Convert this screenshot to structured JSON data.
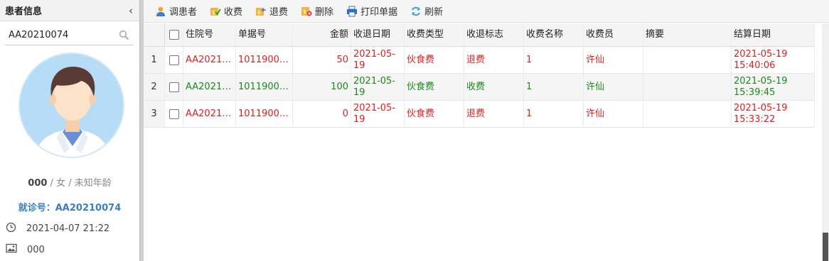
{
  "left": {
    "title": "患者信息",
    "search_value": "AA20210074",
    "patient_id": "000",
    "patient_rest": " / 女 / 未知年龄",
    "visit_no": "就诊号：AA20210074",
    "datetime": "2021-04-07 21:22",
    "photo_text": "000"
  },
  "toolbar": {
    "items": [
      {
        "label": "调患者",
        "icon": "user-icon"
      },
      {
        "label": "收费",
        "icon": "charge-icon"
      },
      {
        "label": "退费",
        "icon": "refund-icon"
      },
      {
        "label": "删除",
        "icon": "delete-icon"
      },
      {
        "label": "打印单据",
        "icon": "print-icon"
      },
      {
        "label": "刷新",
        "icon": "refresh-icon"
      }
    ]
  },
  "grid": {
    "headers": [
      "住院号",
      "单据号",
      "金额",
      "收退日期",
      "收费类型",
      "收退标志",
      "收费名称",
      "收费员",
      "摘要",
      "结算日期"
    ],
    "rows": [
      {
        "num": "1",
        "zyh": "AA2021…",
        "djh": "1011900…",
        "je": "50",
        "rq": "2021-05-19",
        "lx": "伙食费",
        "bz": "退费",
        "mc": "1",
        "sfy": "许仙",
        "zy": "",
        "js": "2021-05-19 15:40:06",
        "color": "#e02020"
      },
      {
        "num": "2",
        "zyh": "AA2021…",
        "djh": "1011900…",
        "je": "100",
        "rq": "2021-05-19",
        "lx": "伙食费",
        "bz": "收费",
        "mc": "1",
        "sfy": "许仙",
        "zy": "",
        "js": "2021-05-19 15:39:45",
        "color": "#1a8a1a"
      },
      {
        "num": "3",
        "zyh": "AA2021…",
        "djh": "1011900…",
        "je": "0",
        "rq": "2021-05-19",
        "lx": "伙食费",
        "bz": "退费",
        "mc": "1",
        "sfy": "许仙",
        "zy": "",
        "js": "2021-05-19 15:33:22",
        "color": "#e02020"
      }
    ]
  }
}
